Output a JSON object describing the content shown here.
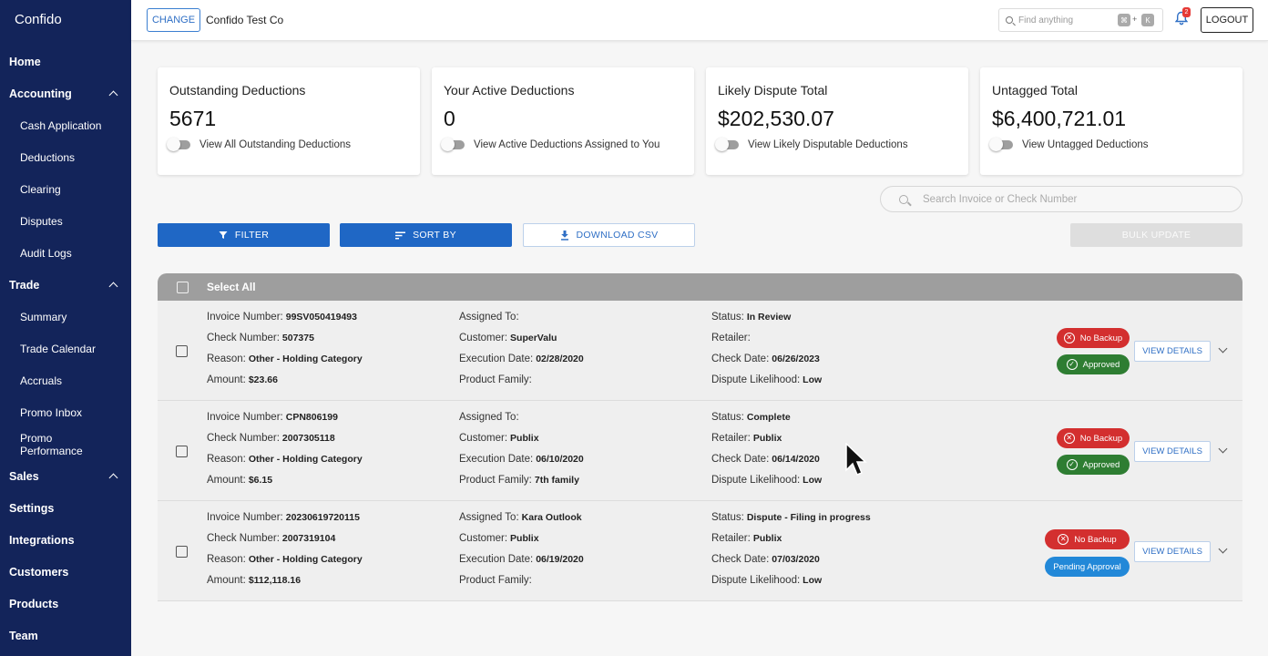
{
  "sidebar": {
    "brand": "Confido",
    "items": [
      {
        "label": "Home",
        "level": "top",
        "expand": false
      },
      {
        "label": "Accounting",
        "level": "top",
        "expand": true
      },
      {
        "label": "Cash Application",
        "level": "sub"
      },
      {
        "label": "Deductions",
        "level": "sub"
      },
      {
        "label": "Clearing",
        "level": "sub"
      },
      {
        "label": "Disputes",
        "level": "sub"
      },
      {
        "label": "Audit Logs",
        "level": "sub"
      },
      {
        "label": "Trade",
        "level": "top",
        "expand": true
      },
      {
        "label": "Summary",
        "level": "sub"
      },
      {
        "label": "Trade Calendar",
        "level": "sub"
      },
      {
        "label": "Accruals",
        "level": "sub"
      },
      {
        "label": "Promo Inbox",
        "level": "sub"
      },
      {
        "label": "Promo Performance",
        "level": "sub"
      },
      {
        "label": "Sales",
        "level": "top",
        "expand": true
      },
      {
        "label": "Settings",
        "level": "top",
        "expand": false
      },
      {
        "label": "Integrations",
        "level": "top",
        "expand": false
      },
      {
        "label": "Customers",
        "level": "top",
        "expand": false
      },
      {
        "label": "Products",
        "level": "top",
        "expand": false
      },
      {
        "label": "Team",
        "level": "top",
        "expand": false
      }
    ]
  },
  "topbar": {
    "change_label": "CHANGE",
    "company": "Confido Test Co",
    "find_placeholder": "Find anything",
    "kbd_1": "⌘",
    "kbd_plus": "+",
    "kbd_2": "K",
    "notification_count": "2",
    "logout_label": "LOGOUT"
  },
  "stats": [
    {
      "title": "Outstanding Deductions",
      "value": "5671",
      "toggle": "View All Outstanding Deductions"
    },
    {
      "title": "Your Active Deductions",
      "value": "0",
      "toggle": "View Active Deductions Assigned to You"
    },
    {
      "title": "Likely Dispute Total",
      "value": "$202,530.07",
      "toggle": "View Likely Disputable Deductions"
    },
    {
      "title": "Untagged Total",
      "value": "$6,400,721.01",
      "toggle": "View Untagged Deductions"
    }
  ],
  "search_invoice_placeholder": "Search Invoice or Check Number",
  "actions": {
    "filter": "FILTER",
    "sort": "SORT BY",
    "download": "DOWNLOAD CSV",
    "bulk": "BULK UPDATE"
  },
  "table": {
    "select_all": "Select All",
    "labels": {
      "invoice": "Invoice Number:",
      "check": "Check Number:",
      "reason": "Reason:",
      "amount": "Amount:",
      "assigned": "Assigned To:",
      "customer": "Customer:",
      "execution": "Execution Date:",
      "family": "Product Family:",
      "status": "Status:",
      "retailer": "Retailer:",
      "check_date": "Check Date:",
      "likelihood": "Dispute Likelihood:"
    },
    "view_details": "VIEW DETAILS",
    "rows": [
      {
        "invoice": "99SV050419493",
        "check": "507375",
        "reason": "Other - Holding Category",
        "amount": "$23.66",
        "assigned": "",
        "customer": "SuperValu",
        "execution": "02/28/2020",
        "family": "",
        "status": "In Review",
        "retailer": "",
        "check_date": "06/26/2023",
        "likelihood": "Low",
        "backup": "No Backup",
        "approval": "Approved",
        "approval_kind": "green"
      },
      {
        "invoice": "CPN806199",
        "check": "2007305118",
        "reason": "Other - Holding Category",
        "amount": "$6.15",
        "assigned": "",
        "customer": "Publix",
        "execution": "06/10/2020",
        "family": "7th family",
        "status": "Complete",
        "retailer": "Publix",
        "check_date": "06/14/2020",
        "likelihood": "Low",
        "backup": "No Backup",
        "approval": "Approved",
        "approval_kind": "green"
      },
      {
        "invoice": "20230619720115",
        "check": "2007319104",
        "reason": "Other - Holding Category",
        "amount": "$112,118.16",
        "assigned": "Kara Outlook",
        "customer": "Publix",
        "execution": "06/19/2020",
        "family": "",
        "status": "Dispute - Filing in progress",
        "retailer": "Publix",
        "check_date": "07/03/2020",
        "likelihood": "Low",
        "backup": "No Backup",
        "approval": "Pending Approval",
        "approval_kind": "blue"
      }
    ]
  },
  "colors": {
    "sidebar_bg": "#13245a",
    "primary": "#1f67c5",
    "no_backup": "#d32f2f",
    "approved": "#2e7d32",
    "pending": "#2288d8"
  }
}
